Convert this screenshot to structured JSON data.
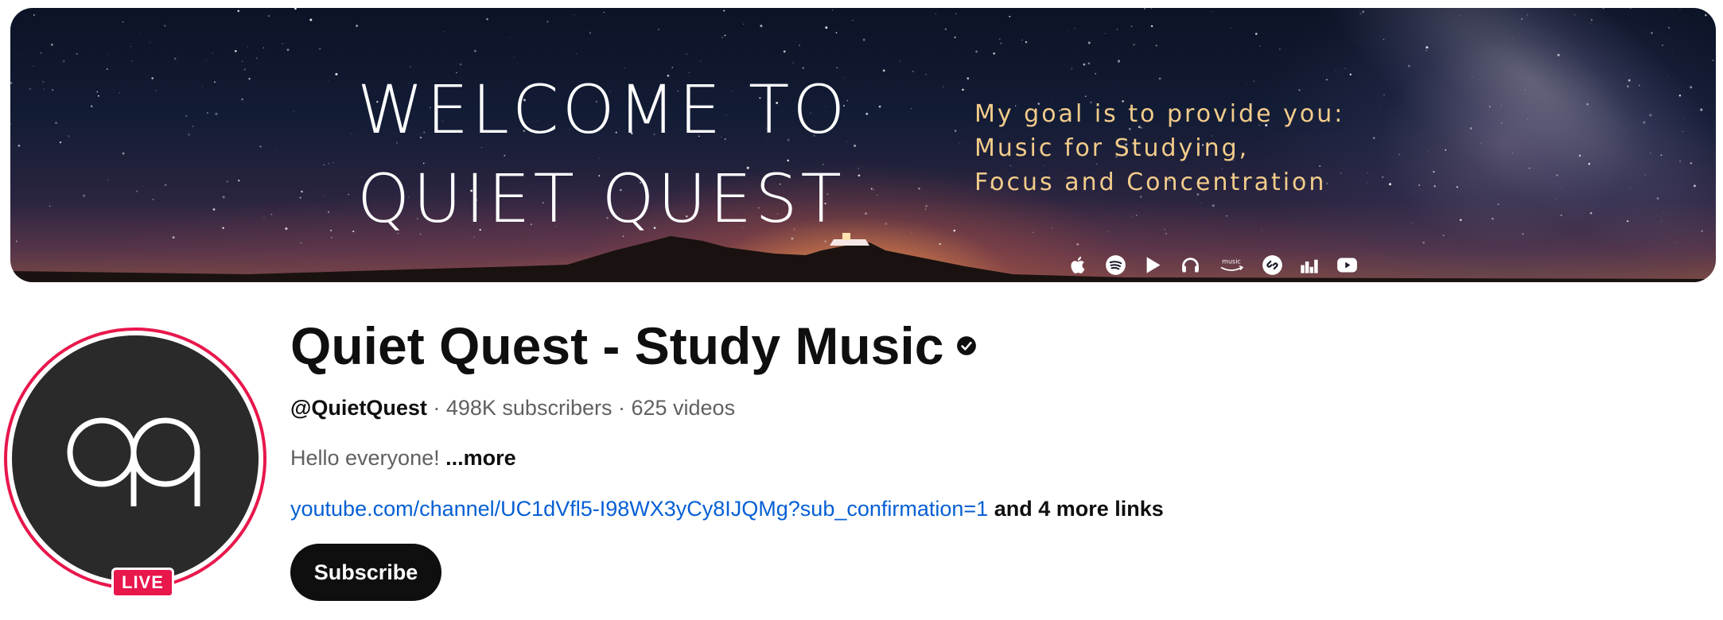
{
  "banner": {
    "title_line1": "WELCOME TO",
    "title_line2": "QUIET QUEST",
    "tagline": [
      "My goal is to provide you:",
      "Music for Studying,",
      "Focus and Concentration"
    ],
    "platform_icons": [
      "apple-icon",
      "spotify-icon",
      "google-play-icon",
      "deezer-icon",
      "amazon-music-icon",
      "shazam-icon",
      "bars-icon",
      "youtube-icon"
    ],
    "platform_amazon_label": "music"
  },
  "channel": {
    "name": "Quiet Quest - Study Music",
    "verified": true,
    "handle": "@QuietQuest",
    "separator": " · ",
    "subscribers": "498K subscribers",
    "videos": "625 videos",
    "description": "Hello everyone!",
    "more_label": "...more",
    "link": "youtube.com/channel/UC1dVfl5-I98WX3yCy8IJQMg?sub_confirmation=1",
    "more_links": "and 4 more links",
    "subscribe_label": "Subscribe",
    "live_label": "LIVE"
  },
  "colors": {
    "live_red": "#e8174c",
    "link_blue": "#065fd4",
    "tagline_gold": "#f2cc8a"
  }
}
